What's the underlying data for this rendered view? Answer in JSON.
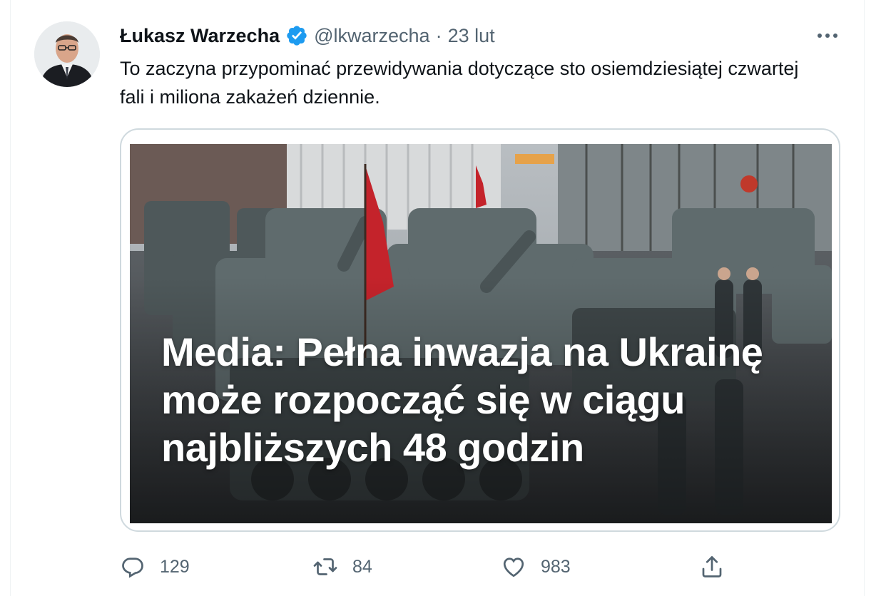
{
  "tweet": {
    "author_name": "Łukasz Warzecha",
    "handle": "@lkwarzecha",
    "separator": "·",
    "date": "23 lut",
    "text": "To zaczyna przypominać przewidywania dotyczące sto osiemdziesiątej czwartej fali i miliona zakażeń dziennie.",
    "media": {
      "headline": "Media: Pełna inwazja na Ukrainę może rozpocząć się w ciągu najbliższych 48 godzin"
    }
  },
  "actions": {
    "replies": "129",
    "retweets": "84",
    "likes": "983"
  },
  "icons": {
    "verified": "verified-badge-icon",
    "more": "more-options-icon",
    "reply": "reply-icon",
    "retweet": "retweet-icon",
    "like": "heart-icon",
    "share": "share-icon"
  },
  "colors": {
    "verified": "#1d9bf0",
    "secondary_text": "#536471",
    "primary_text": "#0f1419",
    "border": "#cfd9de"
  }
}
